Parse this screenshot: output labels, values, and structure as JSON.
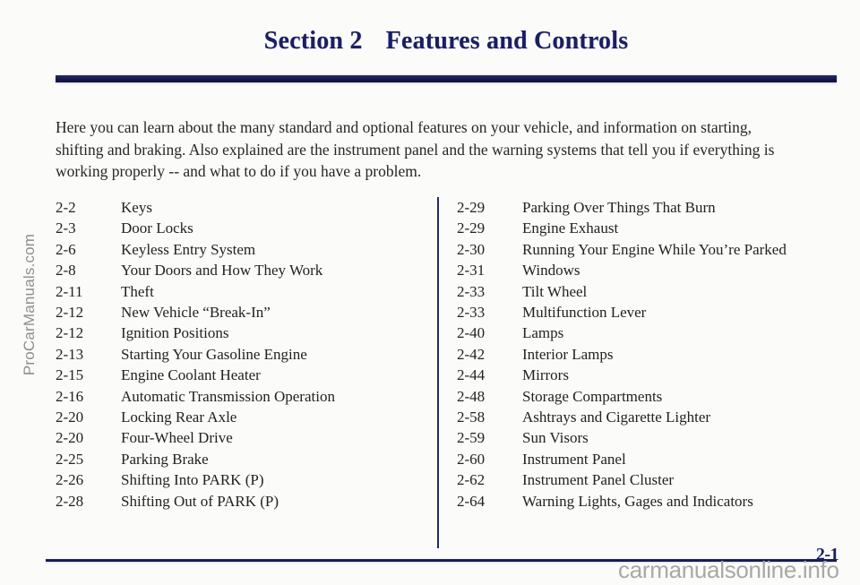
{
  "header": {
    "section_label": "Section 2",
    "section_title": "Features and Controls"
  },
  "intro": {
    "line1": "Here you can learn about the many standard and optional features on your vehicle, and information on starting,",
    "line2": "shifting and braking. Also explained are the instrument panel and the warning systems that tell you if everything is",
    "line3": "working properly -- and what to do if you have a problem."
  },
  "toc": {
    "left": [
      {
        "page": "2-2",
        "title": "Keys"
      },
      {
        "page": "2-3",
        "title": "Door Locks"
      },
      {
        "page": "2-6",
        "title": "Keyless Entry System"
      },
      {
        "page": "2-8",
        "title": "Your Doors and How They Work"
      },
      {
        "page": "2-11",
        "title": "Theft"
      },
      {
        "page": "2-12",
        "title": "New Vehicle “Break-In”"
      },
      {
        "page": "2-12",
        "title": "Ignition Positions"
      },
      {
        "page": "2-13",
        "title": "Starting Your Gasoline Engine"
      },
      {
        "page": "2-15",
        "title": "Engine Coolant Heater"
      },
      {
        "page": "2-16",
        "title": "Automatic Transmission Operation"
      },
      {
        "page": "2-20",
        "title": "Locking Rear Axle"
      },
      {
        "page": "2-20",
        "title": "Four-Wheel Drive"
      },
      {
        "page": "2-25",
        "title": "Parking Brake"
      },
      {
        "page": "2-26",
        "title": "Shifting Into PARK (P)"
      },
      {
        "page": "2-28",
        "title": "Shifting Out of PARK (P)"
      }
    ],
    "right": [
      {
        "page": "2-29",
        "title": "Parking Over Things That Burn"
      },
      {
        "page": "2-29",
        "title": "Engine Exhaust"
      },
      {
        "page": "2-30",
        "title": "Running Your Engine While You’re Parked"
      },
      {
        "page": "2-31",
        "title": "Windows"
      },
      {
        "page": "2-33",
        "title": "Tilt Wheel"
      },
      {
        "page": "2-33",
        "title": "Multifunction Lever"
      },
      {
        "page": "2-40",
        "title": "Lamps"
      },
      {
        "page": "2-42",
        "title": "Interior Lamps"
      },
      {
        "page": "2-44",
        "title": "Mirrors"
      },
      {
        "page": "2-48",
        "title": "Storage Compartments"
      },
      {
        "page": "2-58",
        "title": "Ashtrays and Cigarette Lighter"
      },
      {
        "page": "2-59",
        "title": "Sun Visors"
      },
      {
        "page": "2-60",
        "title": "Instrument Panel"
      },
      {
        "page": "2-62",
        "title": "Instrument Panel Cluster"
      },
      {
        "page": "2-64",
        "title": "Warning Lights, Gages and Indicators"
      }
    ]
  },
  "footer": {
    "page_number": "2-1"
  },
  "watermarks": {
    "side": "ProCarManuals.com",
    "bottom": "carmanualsonline.info"
  },
  "colors": {
    "navy": "#1a1f63",
    "text": "#222222",
    "paper": "#fbfbf9",
    "watermark_gray": "#a8a8a8"
  }
}
